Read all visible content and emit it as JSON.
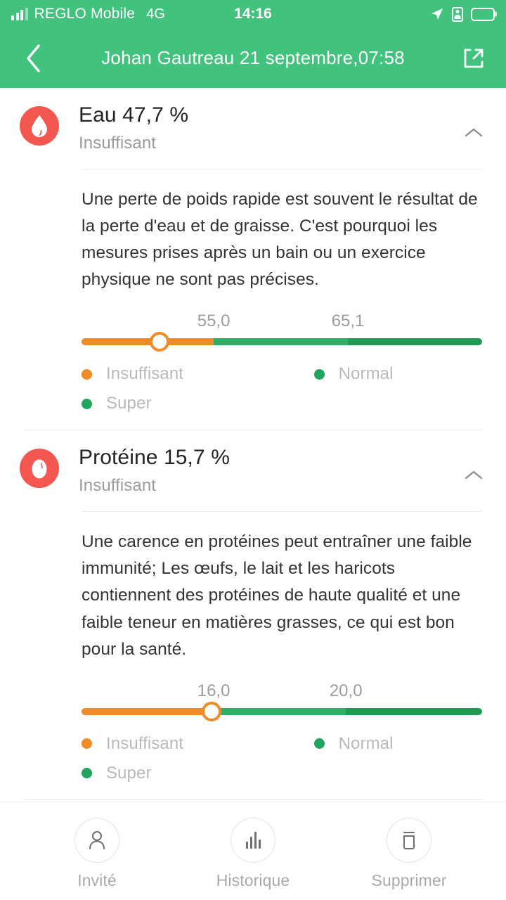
{
  "status_bar": {
    "carrier": "REGLO Mobile",
    "network": "4G",
    "time": "14:16",
    "icons": [
      "signal-bars-icon",
      "location-arrow-icon",
      "id-card-icon",
      "battery-icon"
    ]
  },
  "nav": {
    "title": "Johan Gautreau 21 septembre,07:58",
    "back_icon": "chevron-left-icon",
    "share_icon": "share-external-icon"
  },
  "theme": {
    "header_green": "#41c37d",
    "icon_red": "#f4574f",
    "insufficient_orange": "#ef8b28",
    "normal_green": "#2fae66",
    "super_green": "#1f9a52",
    "muted_text": "#b9b9b9"
  },
  "metrics": [
    {
      "icon": "water-drop-icon",
      "title": "Eau 47,7 %",
      "status": "Insuffisant",
      "collapse_icon": "chevron-up-icon",
      "description": "Une perte de poids rapide est souvent le résultat de la perte d'eau et de graisse.\nC'est pourquoi les mesures prises après un bain ou un exercice physique ne sont pas précises.",
      "ticks": [
        {
          "label": "55,0",
          "pos": 33.0
        },
        {
          "label": "65,1",
          "pos": 66.5
        }
      ],
      "thumb_pos": 19.5,
      "segments": [
        {
          "name": "Insuffisant",
          "start": 0,
          "end": 33.0,
          "color": "#ef8b28"
        },
        {
          "name": "Normal",
          "start": 33.0,
          "end": 66.5,
          "color": "#2fae66"
        },
        {
          "name": "Super",
          "start": 66.5,
          "end": 100,
          "color": "#1f9a52"
        }
      ],
      "legend": [
        {
          "label": "Insuffisant",
          "color": "#f08a26"
        },
        {
          "label": "Normal",
          "color": "#21a45c"
        },
        {
          "label": "Super",
          "color": "#21a45c"
        }
      ]
    },
    {
      "icon": "egg-icon",
      "title": "Protéine 15,7 %",
      "status": "Insuffisant",
      "collapse_icon": "chevron-up-icon",
      "description": "Une carence en protéines peut entraîner une faible immunité; Les œufs, le lait et les haricots contiennent des protéines de haute qualité et une faible teneur en matières grasses, ce qui est bon pour la santé.",
      "ticks": [
        {
          "label": "16,0",
          "pos": 33.0
        },
        {
          "label": "20,0",
          "pos": 66.0
        }
      ],
      "thumb_pos": 32.5,
      "segments": [
        {
          "name": "Insuffisant",
          "start": 0,
          "end": 33.0,
          "color": "#ef8b28"
        },
        {
          "name": "Normal",
          "start": 33.0,
          "end": 66.0,
          "color": "#2fae66"
        },
        {
          "name": "Super",
          "start": 66.0,
          "end": 100,
          "color": "#1f9a52"
        }
      ],
      "legend": [
        {
          "label": "Insuffisant",
          "color": "#f08a26"
        },
        {
          "label": "Normal",
          "color": "#21a45c"
        },
        {
          "label": "Super",
          "color": "#21a45c"
        }
      ]
    }
  ],
  "bottom_bar": [
    {
      "icon": "person-icon",
      "label": "Invité"
    },
    {
      "icon": "bar-chart-icon",
      "label": "Historique"
    },
    {
      "icon": "trash-icon",
      "label": "Supprimer"
    }
  ]
}
